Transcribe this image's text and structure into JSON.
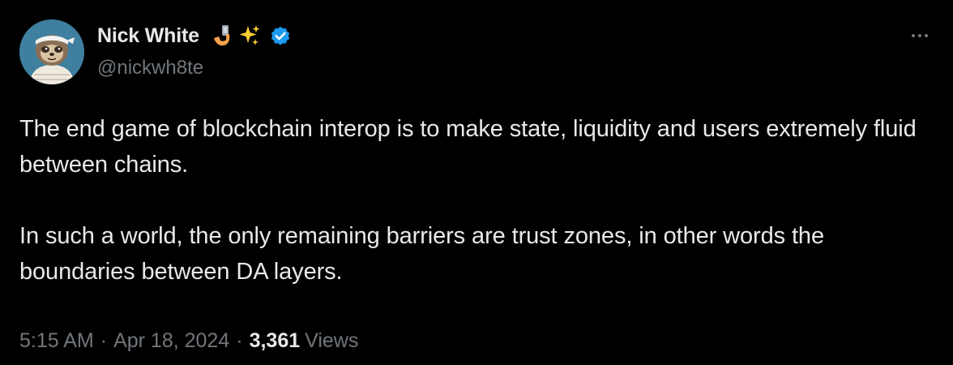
{
  "author": {
    "display_name": "Nick White",
    "handle": "@nickwh8te",
    "verified": true,
    "name_emojis": [
      "selfie-hand-icon",
      "sparkles-icon"
    ],
    "avatar_icon": "sloth-avatar"
  },
  "tweet": {
    "paragraphs": [
      "The end game of blockchain interop is to make state, liquidity and users extremely fluid between chains.",
      "In such a world, the only remaining barriers are trust zones, in other words the boundaries between DA layers."
    ],
    "time": "5:15 AM",
    "separator": "·",
    "date": "Apr 18, 2024",
    "views_count": "3,361",
    "views_label": "Views"
  },
  "icons": {
    "more": "more-icon",
    "verified": "verified-badge-icon"
  },
  "colors": {
    "background": "#000000",
    "primary_text": "#e7e9ea",
    "secondary_text": "#71767b",
    "verified_blue": "#1d9bf0"
  }
}
